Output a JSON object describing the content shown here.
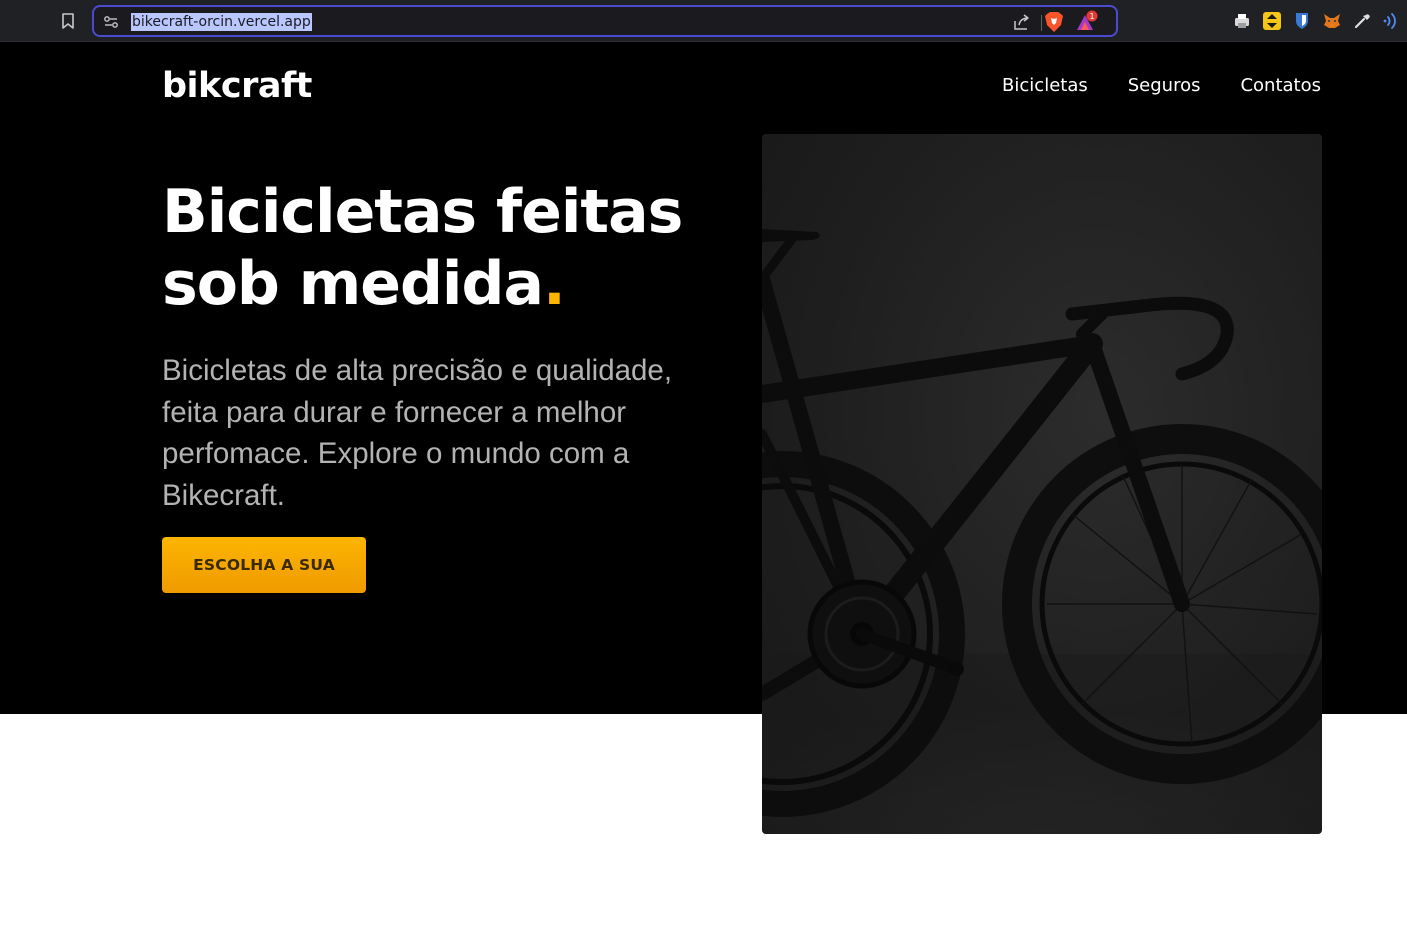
{
  "browser": {
    "url": "bikecraft-orcin.vercel.app",
    "colors": {
      "bar_bg": "#202124",
      "url_border": "#4b4bd0",
      "url_highlight": "#b9c6ff"
    },
    "extensions": [
      "printer-icon",
      "yellow-arrows-extension-icon",
      "bitwarden-shield-icon",
      "metamask-fox-icon",
      "color-picker-icon",
      "wave-signal-icon"
    ],
    "rewards_badge": "1"
  },
  "site": {
    "logo": "bikcraft",
    "nav": [
      "Bicicletas",
      "Seguros",
      "Contatos"
    ],
    "hero": {
      "title_main": "Bicicletas feitas sob medida",
      "title_dot": ".",
      "description": "Bicicletas de alta precisão e qualidade, feita para durar e fornecer a melhor perfomace. Explore o mundo com a Bikecraft.",
      "cta_label": "ESCOLHA A SUA",
      "image_alt": "black-road-bicycle-photo"
    },
    "colors": {
      "background": "#000000",
      "accent": "#fbb500",
      "text": "#ffffff",
      "muted_text": "#b3b3b3"
    }
  }
}
